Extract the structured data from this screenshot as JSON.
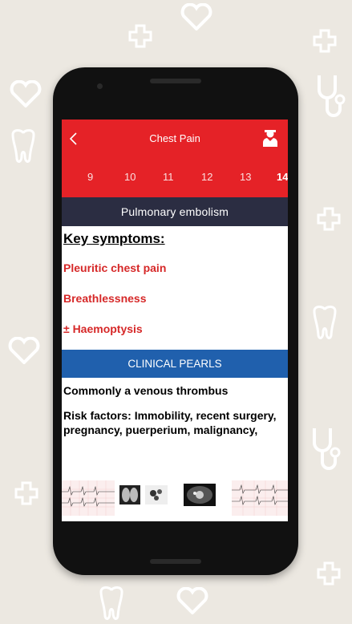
{
  "appbar": {
    "title": "Chest Pain"
  },
  "tabs": [
    "9",
    "10",
    "11",
    "12",
    "13",
    "14"
  ],
  "active_tab": "14",
  "section": {
    "title": "Pulmonary  embolism"
  },
  "key_symptoms": {
    "heading": "Key symptoms:",
    "items": [
      "Pleuritic chest pain",
      "Breathlessness",
      "± Haemoptysis"
    ]
  },
  "pearls": {
    "title": "CLINICAL PEARLS",
    "line1": "Commonly a venous thrombus",
    "line2": "Risk factors: Immobility, recent surgery, pregnancy, puerperium, malignancy,"
  },
  "colors": {
    "red": "#e52227",
    "navy": "#2b2d42",
    "blue": "#2060ad",
    "symptom": "#d62828"
  },
  "icons": [
    "back-chevron-icon",
    "doctor-icon"
  ]
}
